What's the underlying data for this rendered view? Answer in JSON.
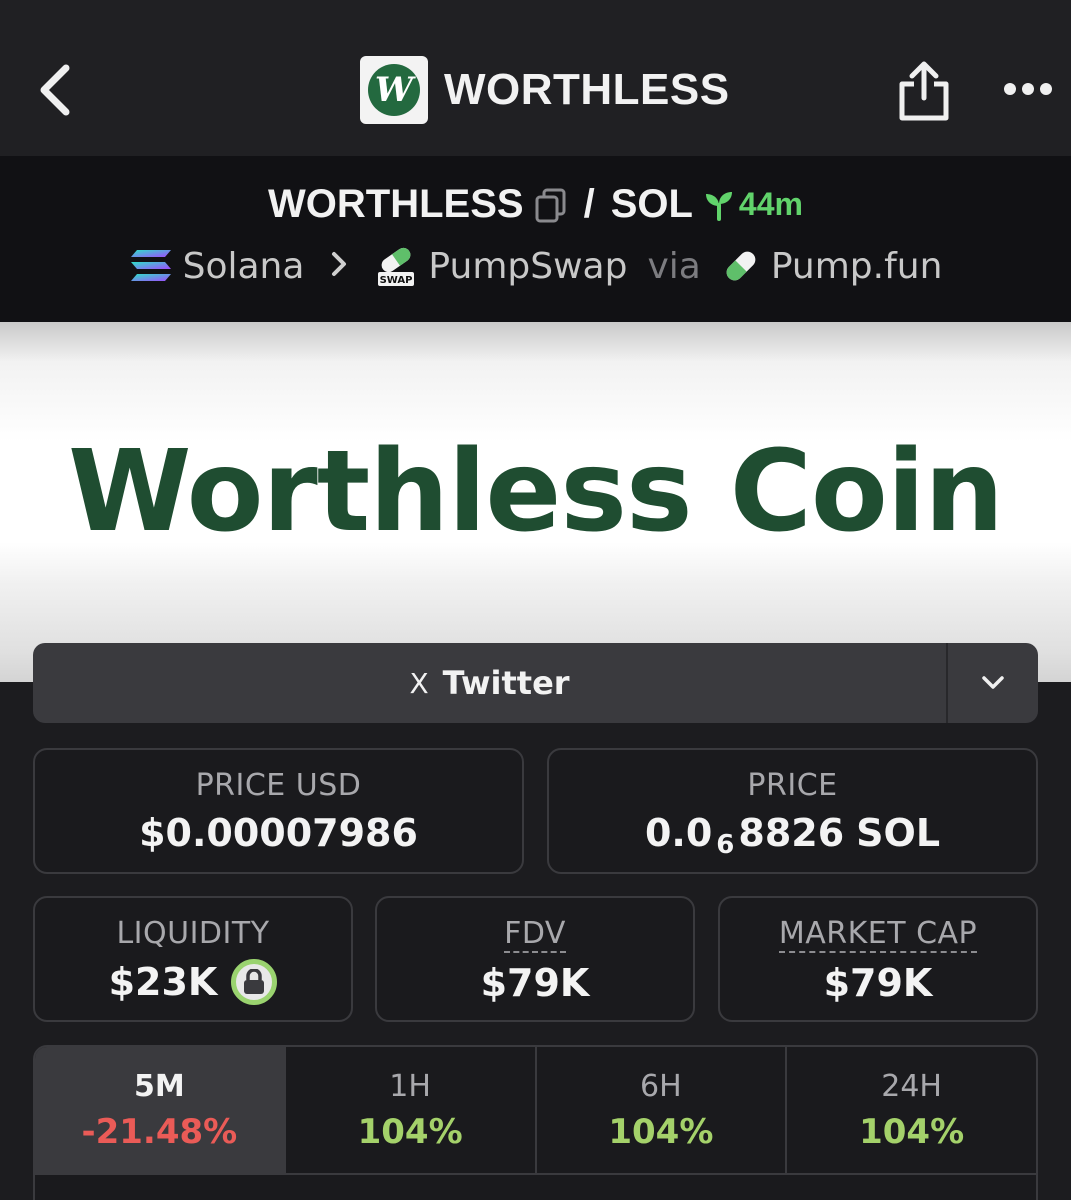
{
  "nav": {
    "title": "WORTHLESS",
    "logo_letter": "W"
  },
  "pair": {
    "base": "WORTHLESS",
    "separator": "/",
    "quote": "SOL",
    "age": "44m",
    "chain": "Solana",
    "dex": "PumpSwap",
    "via": "via",
    "launchpad": "Pump.fun",
    "dex_badge": "SWAP"
  },
  "banner": {
    "text": "Worthless Coin"
  },
  "social": {
    "twitter_label": "Twitter",
    "twitter_icon": "X"
  },
  "stats": {
    "price_usd_label": "PRICE USD",
    "price_usd": "$0.00007986",
    "price_label": "PRICE",
    "price_lead": "0.0",
    "price_zeros": "6",
    "price_digits": "8826",
    "price_unit": "SOL",
    "liquidity_label": "LIQUIDITY",
    "liquidity": "$23K",
    "fdv_label": "FDV",
    "fdv": "$79K",
    "mcap_label": "MARKET CAP",
    "mcap": "$79K"
  },
  "timeframes": [
    {
      "period": "5M",
      "change": "-21.48%",
      "trend": "down",
      "active": true
    },
    {
      "period": "1H",
      "change": "104%",
      "trend": "up",
      "active": false
    },
    {
      "period": "6H",
      "change": "104%",
      "trend": "up",
      "active": false
    },
    {
      "period": "24H",
      "change": "104%",
      "trend": "up",
      "active": false
    }
  ],
  "colors": {
    "up": "#a4d16a",
    "down": "#ea5b57",
    "age": "#61d36b",
    "brand_green": "#23693f"
  }
}
